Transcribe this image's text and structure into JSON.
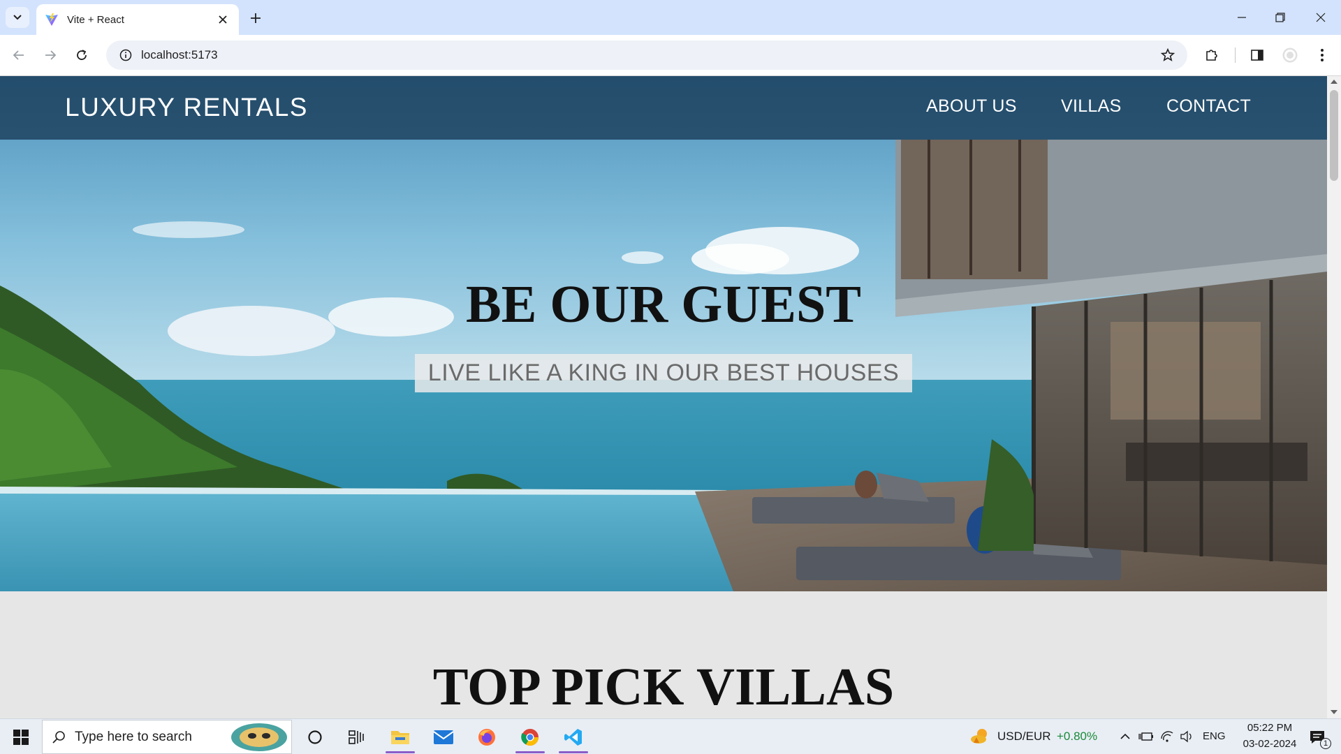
{
  "browser": {
    "tab_title": "Vite + React",
    "url": "localhost:5173"
  },
  "site": {
    "brand": "LUXURY RENTALS",
    "nav": [
      "ABOUT US",
      "VILLAS",
      "CONTACT"
    ],
    "hero_title": "BE OUR GUEST",
    "hero_subtitle": "LIVE LIKE A KING IN OUR BEST HOUSES",
    "section_title": "TOP PICK VILLAS"
  },
  "taskbar": {
    "search_placeholder": "Type here to search",
    "ticker_label": "USD/EUR",
    "ticker_change": "+0.80%",
    "language": "ENG",
    "time": "05:22 PM",
    "date": "03-02-2024",
    "notification_count": "1"
  },
  "colors": {
    "tabbar": "#d3e3fd",
    "header_overlay": "#183a56",
    "ticker_positive": "#1a8a3a"
  }
}
